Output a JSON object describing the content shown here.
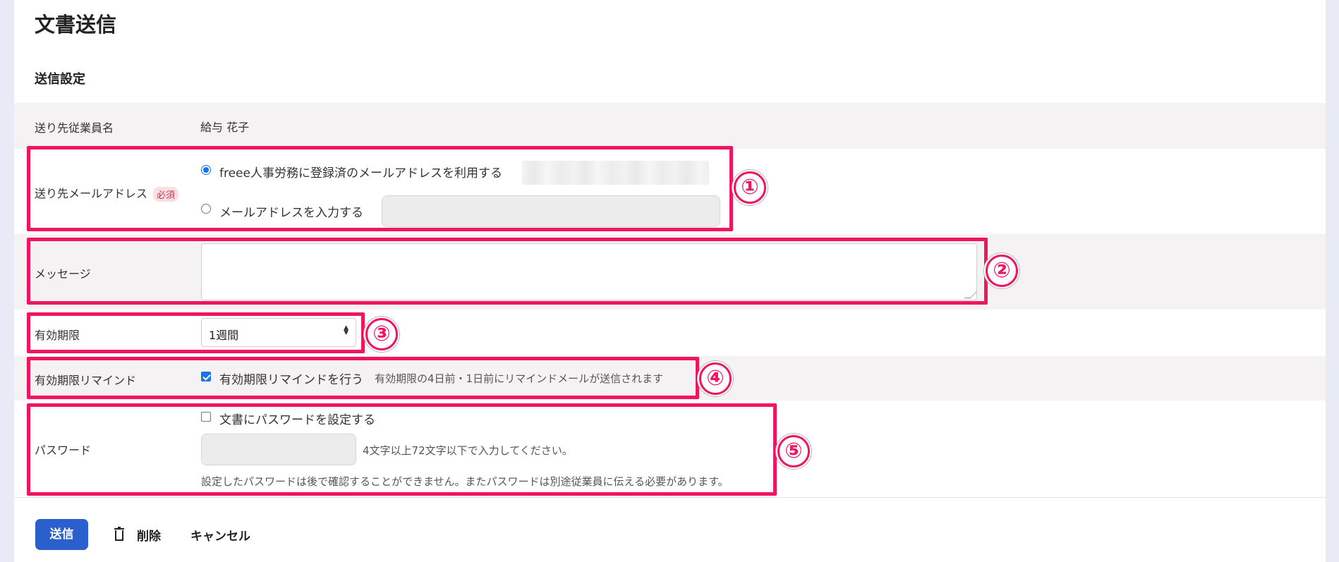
{
  "page": {
    "title": "文書送信",
    "section_title": "送信設定"
  },
  "employee": {
    "label": "送り先従業員名",
    "value": "給与 花子"
  },
  "email": {
    "label": "送り先メールアドレス",
    "required_badge": "必須",
    "option_registered": "freee人事労務に登録済のメールアドレスを利用する",
    "option_input": "メールアドレスを入力する",
    "selected": "registered"
  },
  "message": {
    "label": "メッセージ",
    "value": ""
  },
  "expiry": {
    "label": "有効期限",
    "selected": "1週間"
  },
  "remind": {
    "label": "有効期限リマインド",
    "checkbox_label": "有効期限リマインドを行う",
    "checked": true,
    "hint": "有効期限の4日前・1日前にリマインドメールが送信されます"
  },
  "password": {
    "label": "パスワード",
    "checkbox_label": "文書にパスワードを設定する",
    "checked": false,
    "hint": "4文字以上72文字以下で入力してください。",
    "note": "設定したパスワードは後で確認することができません。またパスワードは別途従業員に伝える必要があります。"
  },
  "annotations": [
    "①",
    "②",
    "③",
    "④",
    "⑤"
  ],
  "footer": {
    "send_label": "送信",
    "delete_label": "削除",
    "cancel_label": "キャンセル"
  },
  "colors": {
    "highlight": "#f0165e",
    "primary_button": "#2b5fcb",
    "row_gray": "#f4f2f2",
    "page_bg": "#e8eaf6"
  }
}
